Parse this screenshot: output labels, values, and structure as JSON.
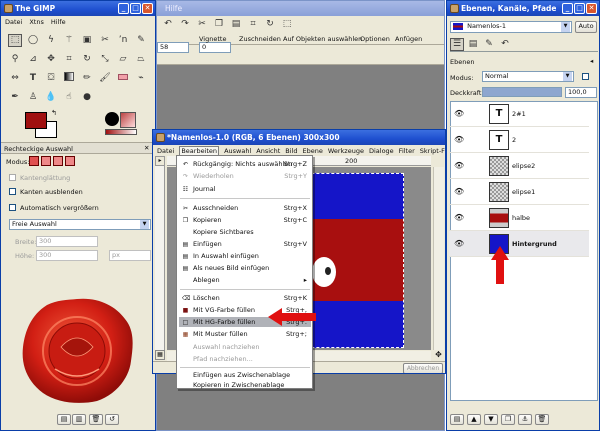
{
  "toolbox": {
    "title": "The GIMP",
    "menu": [
      "Datei",
      "Xtns",
      "Hilfe"
    ],
    "options_title": "Rechteckige Auswahl",
    "mode_label": "Modus:",
    "antialias_label": "Kantenglättung",
    "feather_label": "Kanten ausblenden",
    "autogrow_label": "Automatisch vergrößern",
    "select_value": "Freie Auswahl",
    "width_label": "Breite:",
    "width_value": "300",
    "height_label": "Höhe:",
    "height_value": "300",
    "unit": "px",
    "fg_color": "#a01010",
    "bg_color": "#ffffff"
  },
  "background_window": {
    "title_fragment": "Hilfe",
    "toolbar_items": [
      "Vignette",
      "Zuschneiden",
      "Auf Objekten auswählen",
      "Optionen",
      "Anfügen"
    ],
    "zoom_value": "58",
    "offset_value": "0"
  },
  "image_window": {
    "title": "*Namenlos-1.0 (RGB, 6 Ebenen) 300x300",
    "menu": [
      "Datei",
      "Bearbeiten",
      "Auswahl",
      "Ansicht",
      "Bild",
      "Ebene",
      "Werkzeuge",
      "Dialoge",
      "Filter",
      "Skript-Fu"
    ],
    "ruler_mark": "200",
    "cancel_label": "Abbrechen"
  },
  "edit_menu": {
    "items": [
      {
        "icon": "↶",
        "label": "Rückgängig: Nichts auswählen",
        "shortcut": "Strg+Z",
        "disabled": false
      },
      {
        "icon": "↷",
        "label": "Wiederholen",
        "shortcut": "Strg+Y",
        "disabled": true
      },
      {
        "icon": "☷",
        "label": "Journal",
        "shortcut": "",
        "disabled": false
      },
      {
        "icon": "✂",
        "label": "Ausschneiden",
        "shortcut": "Strg+X",
        "disabled": false
      },
      {
        "icon": "❐",
        "label": "Kopieren",
        "shortcut": "Strg+C",
        "disabled": false
      },
      {
        "icon": "",
        "label": "Kopiere Sichtbares",
        "shortcut": "",
        "disabled": false
      },
      {
        "icon": "▤",
        "label": "Einfügen",
        "shortcut": "Strg+V",
        "disabled": false
      },
      {
        "icon": "▤",
        "label": "In Auswahl einfügen",
        "shortcut": "",
        "disabled": false
      },
      {
        "icon": "▤",
        "label": "Als neues Bild einfügen",
        "shortcut": "",
        "disabled": false
      },
      {
        "icon": "",
        "label": "Ablegen",
        "shortcut": "▸",
        "disabled": false
      },
      {
        "icon": "⌫",
        "label": "Löschen",
        "shortcut": "Strg+K",
        "disabled": false
      },
      {
        "icon": "■",
        "label": "Mit VG-Farbe füllen",
        "shortcut": "Strg+,",
        "disabled": false
      },
      {
        "icon": "□",
        "label": "Mit HG-Farbe füllen",
        "shortcut": "Strg+.",
        "disabled": false
      },
      {
        "icon": "▦",
        "label": "Mit Muster füllen",
        "shortcut": "Strg+;",
        "disabled": false
      },
      {
        "icon": "",
        "label": "Auswahl nachziehen",
        "shortcut": "",
        "disabled": true
      },
      {
        "icon": "",
        "label": "Pfad nachziehen...",
        "shortcut": "",
        "disabled": true
      },
      {
        "icon": "",
        "label": "Einfügen aus Zwischenablage",
        "shortcut": "",
        "disabled": false
      },
      {
        "icon": "",
        "label": "Kopieren in Zwischenablage",
        "shortcut": "",
        "disabled": false
      }
    ],
    "highlighted_label": "Mit HG-Farbe füllen"
  },
  "layers_dock": {
    "title": "Ebenen, Kanäle, Pfade",
    "image_select": "Namenlos-1",
    "auto_label": "Auto",
    "section_label": "Ebenen",
    "mode_label": "Modus:",
    "mode_value": "Normal",
    "opacity_label": "Deckkraft:",
    "opacity_value": "100,0",
    "opacity_fraction": 1.0,
    "layers": [
      {
        "name": "2#1",
        "thumb": "text"
      },
      {
        "name": "2",
        "thumb": "text"
      },
      {
        "name": "elipse2",
        "thumb": "checker"
      },
      {
        "name": "elipse1",
        "thumb": "checker"
      },
      {
        "name": "halbe",
        "thumb": "red"
      },
      {
        "name": "Hintergrund",
        "thumb": "blue",
        "selected": true
      }
    ]
  },
  "colors": {
    "titlebar": "#1e4fcf",
    "flag_blue": "#1515c8",
    "flag_red": "#a80f0f",
    "arrow_red": "#e01010",
    "seal_red": "#d21f14"
  }
}
